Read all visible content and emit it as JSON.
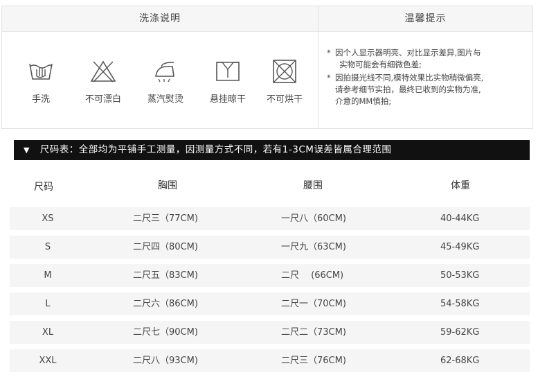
{
  "care": {
    "title": "洗涤说明",
    "icons": [
      {
        "name": "hand-wash-icon",
        "label": "手洗"
      },
      {
        "name": "no-bleach-icon",
        "label": "不可漂白"
      },
      {
        "name": "steam-iron-icon",
        "label": "蒸汽熨烫"
      },
      {
        "name": "hang-dry-icon",
        "label": "悬挂晾干"
      },
      {
        "name": "no-tumble-dry-icon",
        "label": "不可烘干"
      }
    ]
  },
  "tips": {
    "title": "温馨提示",
    "star": "*",
    "items": [
      {
        "line1": "因个人显示器明亮、对比显示差异,图片与",
        "line2": "实物可能会有细微色差;"
      },
      {
        "line1": "因拍摄光线不同,模特效果比实物稍微偏亮,",
        "line2": "请参考细节实拍，最终已收到的实物为准,",
        "line3": "介意的MM慎拍;"
      }
    ]
  },
  "banner": {
    "marker": "▼",
    "text": "尺码表：全部均为平铺手工测量，因测量方式不同，若有1-3CM误差皆属合理范围"
  },
  "size_table": {
    "headers": [
      "尺码",
      "胸围",
      "腰围",
      "体重"
    ],
    "rows": [
      [
        "XS",
        "二尺三（77CM)",
        "一尺八（60CM)",
        "40-44KG"
      ],
      [
        "S",
        "二尺四（80CM)",
        "一尺九（63CM)",
        "45-49KG"
      ],
      [
        "M",
        "二尺五（83CM)",
        "二尺　 (66CM)",
        "50-53KG"
      ],
      [
        "L",
        "二尺六（86CM)",
        "二尺一（70CM)",
        "54-58KG"
      ],
      [
        "XL",
        "二尺七（90CM)",
        "二尺二（73CM)",
        "59-62KG"
      ],
      [
        "XXL",
        "二尺八（93CM)",
        "二尺三（76CM)",
        "62-68KG"
      ]
    ]
  }
}
